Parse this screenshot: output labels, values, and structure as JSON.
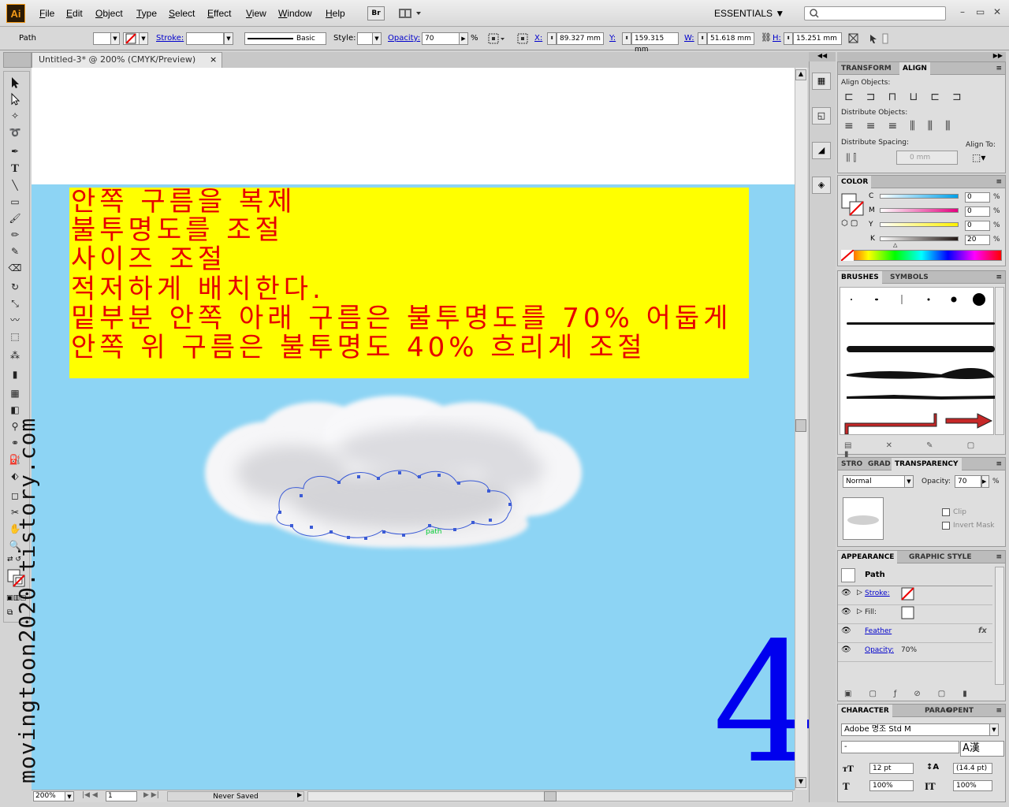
{
  "app": {
    "logo": "Ai"
  },
  "menu": [
    "File",
    "Edit",
    "Object",
    "Type",
    "Select",
    "Effect",
    "View",
    "Window",
    "Help"
  ],
  "menubar": {
    "bridge": "Br",
    "workspace": "ESSENTIALS ▼",
    "window_controls": [
      "–",
      "▭",
      "✕"
    ]
  },
  "control": {
    "selection": "Path",
    "stroke_label": "Stroke:",
    "brush": "Basic",
    "style_label": "Style:",
    "opacity_label": "Opacity:",
    "opacity": "70",
    "pct": "%",
    "x_label": "X:",
    "x": "89.327 mm",
    "y_label": "Y:",
    "y": "159.315 mm",
    "w_label": "W:",
    "w": "51.618 mm",
    "h_label": "H:",
    "h": "15.251 mm"
  },
  "document": {
    "tab_title": "Untitled-3* @ 200% (CMYK/Preview)",
    "close": "×",
    "text_lines": [
      "안쪽 구름을 복제",
      "불투명도를 조절",
      "사이즈 조절",
      "적저하게 배치한다.",
      "밑부분 안쪽 아래 구름은 불투명도를 70% 어둡게",
      "안쪽 위 구름은 불투명도 40% 흐리게 조절"
    ],
    "watermark": "movingtoon2020.tistory.com",
    "big_number": "4",
    "path_label": "path"
  },
  "status": {
    "zoom": "200%",
    "page": "1",
    "save_state": "Never Saved"
  },
  "panels": {
    "align": {
      "tabs": [
        "TRANSFORM",
        "ALIGN"
      ],
      "align_objects": "Align Objects:",
      "distribute_objects": "Distribute Objects:",
      "distribute_spacing": "Distribute Spacing:",
      "align_to": "Align To:",
      "spacing_value": "0 mm"
    },
    "color": {
      "title": "COLOR",
      "channels": [
        {
          "name": "C",
          "value": "0",
          "color": "#00a0e9"
        },
        {
          "name": "M",
          "value": "0",
          "color": "#e4007f"
        },
        {
          "name": "Y",
          "value": "0",
          "color": "#fff100"
        },
        {
          "name": "K",
          "value": "20",
          "color": "#231815"
        }
      ],
      "pct": "%"
    },
    "brushes": {
      "tabs": [
        "BRUSHES",
        "SYMBOLS"
      ]
    },
    "transparency": {
      "tabs": [
        "STRO",
        "GRAD",
        "TRANSPARENCY"
      ],
      "mode": "Normal",
      "opacity_label": "Opacity:",
      "opacity": "70",
      "pct": "%",
      "clip": "Clip",
      "invert_mask": "Invert Mask"
    },
    "appearance": {
      "tabs": [
        "APPEARANCE",
        "GRAPHIC STYLE"
      ],
      "object": "Path",
      "stroke": "Stroke:",
      "fill": "Fill:",
      "feather": "Feather",
      "fx": "fx",
      "opacity_label": "Opacity:",
      "opacity": "70%"
    },
    "character": {
      "tabs": [
        "CHARACTER",
        "PARAG",
        "OPENT"
      ],
      "font": "Adobe 명조 Std M",
      "style": "-",
      "size": "12 pt",
      "leading": "(14.4 pt)",
      "hscale": "100%",
      "vscale": "100%",
      "ime": "A漢"
    }
  }
}
